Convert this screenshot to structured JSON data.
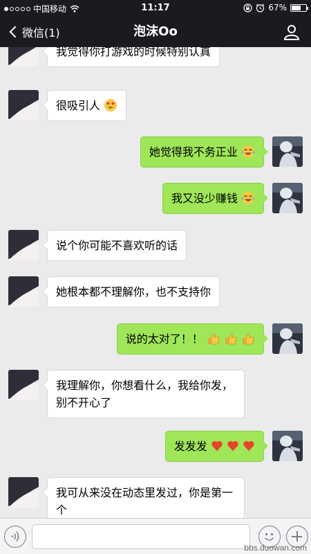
{
  "status_bar": {
    "carrier": "中国移动",
    "time": "11:17",
    "battery": "67%",
    "battery_level": 0.67,
    "signal_bars": 1,
    "icons": [
      "wifi-icon",
      "orientation-lock-icon",
      "alarm-icon",
      "battery-icon"
    ]
  },
  "nav": {
    "back_label": "微信(1)",
    "title": "泡沫Oo",
    "right_icon": "person-icon"
  },
  "messages": [
    {
      "from": "other",
      "text": "我觉得你打游戏的时候特别认真",
      "emoji": []
    },
    {
      "from": "other",
      "text": "很吸引人",
      "emoji": [
        "heart-eyes-emoji"
      ]
    },
    {
      "from": "me",
      "text": "她觉得我不务正业",
      "emoji": [
        "tears-of-joy-emoji"
      ]
    },
    {
      "from": "me",
      "text": "我又没少赚钱",
      "emoji": [
        "tears-of-joy-emoji"
      ]
    },
    {
      "from": "other",
      "text": "说个你可能不喜欢听的话",
      "emoji": []
    },
    {
      "from": "other",
      "text": "她根本都不理解你，也不支持你",
      "emoji": []
    },
    {
      "from": "me",
      "text": "说的太对了！！",
      "emoji": [
        "thumbs-up-emoji",
        "thumbs-up-emoji",
        "thumbs-up-emoji"
      ]
    },
    {
      "from": "other",
      "text": "我理解你，你想看什么，我给你发，别不开心了",
      "emoji": []
    },
    {
      "from": "me",
      "text": "发发发",
      "emoji": [
        "heart-emoji",
        "heart-emoji",
        "heart-emoji"
      ]
    },
    {
      "from": "other",
      "text": "我可从来没在动态里发过，你是第一个",
      "emoji": []
    }
  ],
  "input_bar": {
    "icons": [
      "voice-icon",
      "emoji-icon",
      "plus-icon"
    ]
  },
  "watermark": "bbs.duowan.com",
  "colors": {
    "outgoing_bubble": "#9fe658",
    "incoming_bubble": "#ffffff",
    "chat_background": "#ebebeb",
    "nav_background": "#1b1a1f"
  }
}
